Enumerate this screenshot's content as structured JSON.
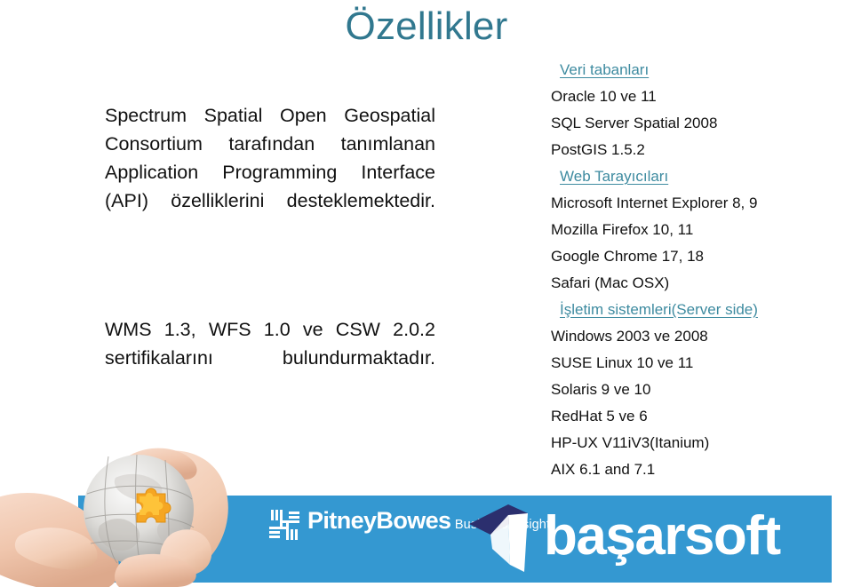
{
  "slide": {
    "title": "Özellikler",
    "title_color": "#31788f",
    "accent_color": "#3e8ba0",
    "footer_bar_color": "#3498d1",
    "logo_navy_color": "#2b2f6e"
  },
  "left": {
    "paragraph1": "Spectrum Spatial Open Geospatial Consortium tarafından tanımlanan Application Programming Interface (API) özelliklerini desteklemektedir.",
    "paragraph2": "WMS 1.3, WFS 1.0 ve CSW 2.0.2 sertifikalarını bulundurmaktadır."
  },
  "right": {
    "sections": [
      {
        "heading": "Veri tabanları",
        "items": [
          "Oracle 10 ve 11",
          "SQL Server Spatial 2008",
          "PostGIS 1.5.2"
        ]
      },
      {
        "heading": "Web Tarayıcıları",
        "items": [
          "Microsoft Internet Explorer 8, 9",
          "Mozilla Firefox 10, 11",
          "Google Chrome 17, 18",
          "Safari (Mac OSX)"
        ]
      },
      {
        "heading": "İşletim sistemleri(Server side)",
        "items": [
          "Windows 2003 ve 2008",
          "SUSE Linux 10 ve 11",
          "Solaris 9 ve 10",
          "RedHat 5 ve 6",
          "HP-UX V11iV3(Itanium)",
          "AIX 6.1 and 7.1"
        ]
      }
    ]
  },
  "footer": {
    "pitney_bowes": {
      "name": "PitneyBowes",
      "tagline": "Business Insight",
      "mark": "woven-grid-icon"
    },
    "basarsoft": {
      "name": "başarsoft",
      "mark": "arrow-3d-icon"
    }
  },
  "photo": {
    "alt": "hands-holding-puzzle-globe",
    "highlight_piece_color": "#f5a623"
  }
}
